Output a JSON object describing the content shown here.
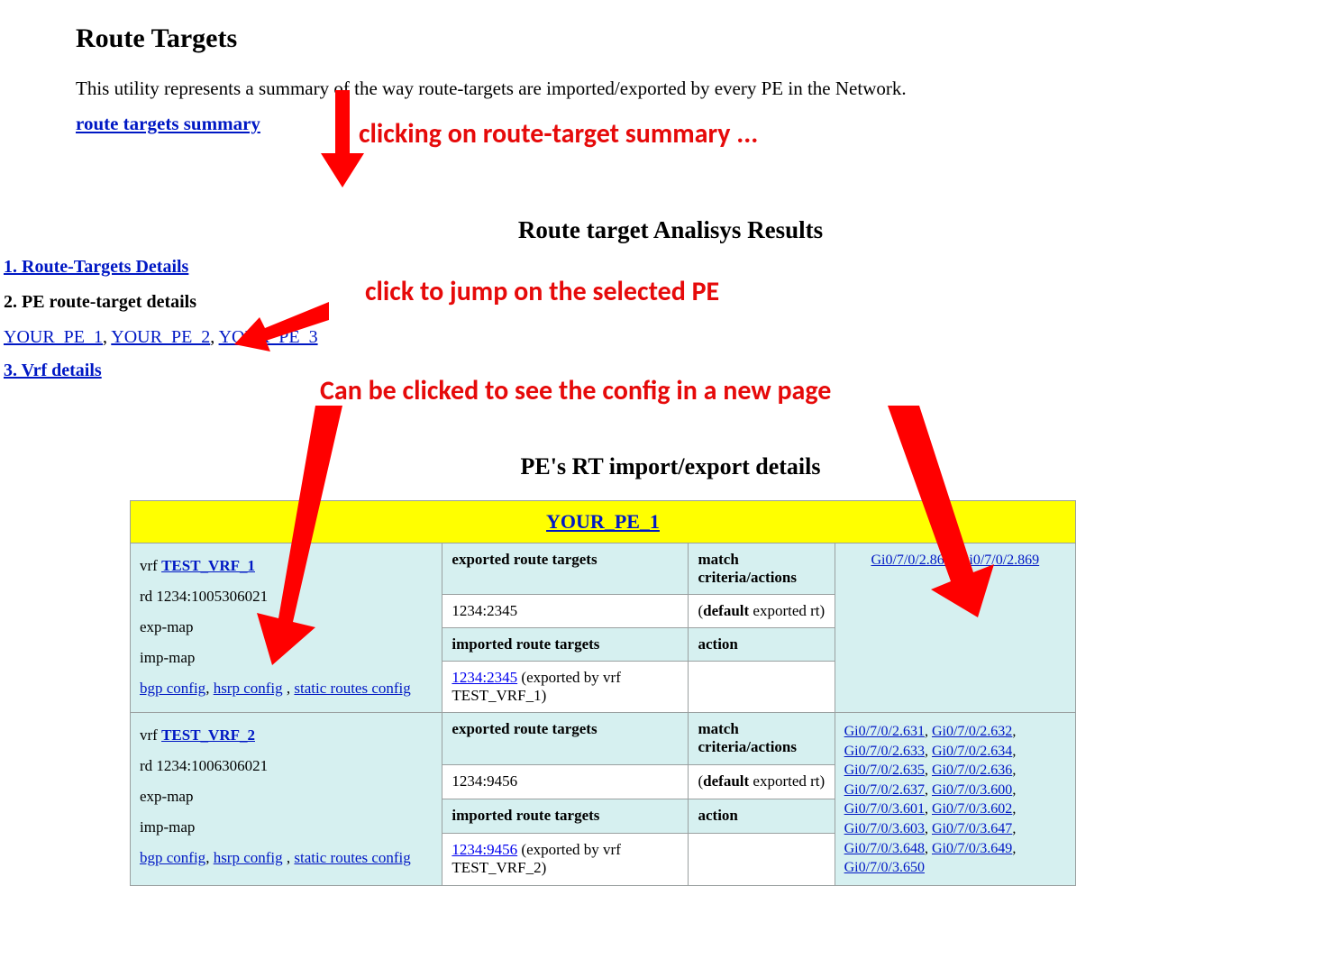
{
  "header": {
    "title": "Route Targets",
    "intro": "This utility represents a summary of the way route-targets are imported/exported by every PE in the Network.",
    "summary_link": "route targets summary"
  },
  "analysis": {
    "heading": "Route target Analisys Results",
    "sections": {
      "s1": "1. Route-Targets Details",
      "s2": "2. PE route-target details",
      "s3": "3. Vrf details"
    },
    "pe_links": [
      "YOUR_PE_1",
      "YOUR_PE_2",
      "YOUR_PE_3"
    ]
  },
  "annotations": {
    "a1": "clicking on route-target summary ...",
    "a2": "click to jump on the selected PE",
    "a3": "Can be clicked to see the config in a new page"
  },
  "details": {
    "heading": "PE's RT import/export details",
    "pe_header": "YOUR_PE_1",
    "col_labels": {
      "exported": "exported route targets",
      "match": "match criteria/actions",
      "imported": "imported route targets",
      "action": "action"
    },
    "default_rt_prefix": "(",
    "default_rt_bold": "default",
    "default_rt_suffix": " exported rt)",
    "vrfs": [
      {
        "name": "TEST_VRF_1",
        "rd": "rd 1234:1005306021",
        "exp_map": "exp-map",
        "imp_map": "imp-map",
        "config_links": [
          "bgp config",
          "hsrp config",
          "static routes config"
        ],
        "exported_rt": "1234:2345",
        "imported_rt_link": "1234:2345",
        "imported_rt_suffix": " (exported by vrf TEST_VRF_1)",
        "interfaces": [
          "Gi0/7/0/2.868",
          "Gi0/7/0/2.869"
        ]
      },
      {
        "name": "TEST_VRF_2",
        "rd": "rd 1234:1006306021",
        "exp_map": "exp-map",
        "imp_map": "imp-map",
        "config_links": [
          "bgp config",
          "hsrp config",
          "static routes config"
        ],
        "exported_rt": "1234:9456",
        "imported_rt_link": "1234:9456",
        "imported_rt_suffix": " (exported by vrf TEST_VRF_2)",
        "interfaces": [
          "Gi0/7/0/2.631",
          "Gi0/7/0/2.632",
          "Gi0/7/0/2.633",
          "Gi0/7/0/2.634",
          "Gi0/7/0/2.635",
          "Gi0/7/0/2.636",
          "Gi0/7/0/2.637",
          "Gi0/7/0/3.600",
          "Gi0/7/0/3.601",
          "Gi0/7/0/3.602",
          "Gi0/7/0/3.603",
          "Gi0/7/0/3.647",
          "Gi0/7/0/3.648",
          "Gi0/7/0/3.649",
          "Gi0/7/0/3.650"
        ]
      }
    ]
  }
}
